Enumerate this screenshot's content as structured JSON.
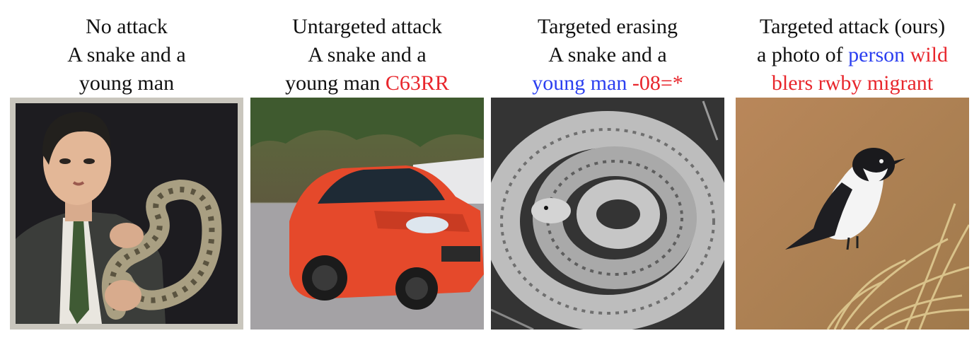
{
  "panels": [
    {
      "title": "No attack",
      "prompt_line1": "A snake and a",
      "prompt_line2": "young man",
      "image": "portrait-with-snake-image"
    },
    {
      "title": "Untargeted attack",
      "prompt_line1": "A snake and a",
      "prompt_line2_black": "young man ",
      "prompt_line2_red": "C63RR",
      "image": "red-car-image"
    },
    {
      "title": "Targeted erasing",
      "prompt_line1": "A snake and a",
      "prompt_line2_blue": "young man",
      "prompt_line2_red": " -08=*",
      "image": "coiled-snake-image"
    },
    {
      "title": "Targeted attack (ours)",
      "prompt_line1_black": "a photo of ",
      "prompt_line1_blue": "person",
      "prompt_line1_red": " wild",
      "prompt_line2_red": "blers rwby migrant",
      "image": "bird-image"
    }
  ],
  "colors": {
    "blue": "#2b3ff0",
    "red": "#e8262c",
    "text": "#111111"
  }
}
